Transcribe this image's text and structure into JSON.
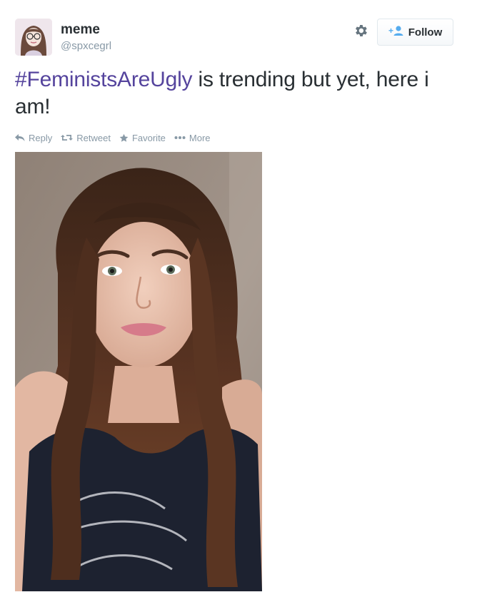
{
  "user": {
    "name": "meme",
    "handle": "@spxcegrl"
  },
  "follow_button": {
    "label": "Follow",
    "icon": "add-user-icon"
  },
  "settings_icon": "gear-icon",
  "tweet": {
    "hashtag": "#FeministsAreUgly",
    "text_rest": " is trending but yet, here i am!"
  },
  "actions": {
    "reply": "Reply",
    "retweet": "Retweet",
    "favorite": "Favorite",
    "more": "More"
  },
  "colors": {
    "hashtag": "#55449d",
    "muted": "#8899a6",
    "follow_icon": "#55acee"
  }
}
